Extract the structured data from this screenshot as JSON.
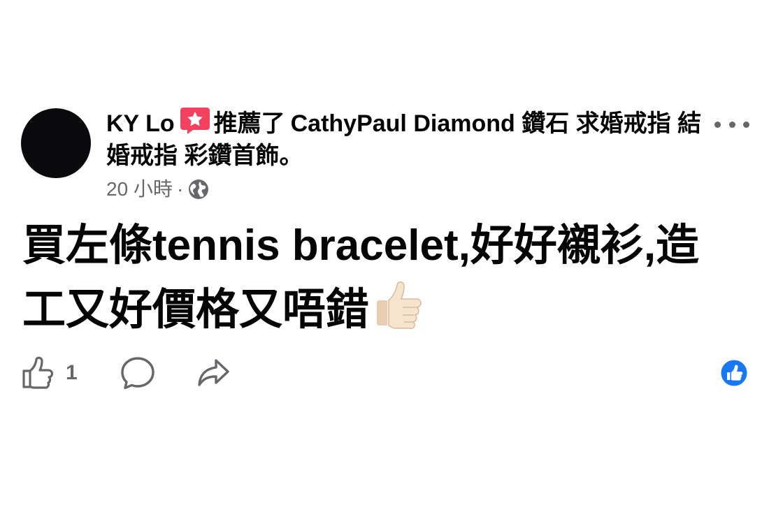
{
  "post": {
    "author": "KY Lo",
    "verb": "推薦了",
    "page_name": "CathyPaul Diamond 鑽石 求婚戒指 結婚戒指 彩鑽首飾。",
    "timestamp": "20 小時",
    "separator": "·",
    "privacy_icon": "globe-icon",
    "body": "買左條tennis bracelet,好好襯衫,造工又好價格又唔錯",
    "emoji": "thumbs-up-light-skin-emoji"
  },
  "actions": {
    "like_count": "1",
    "like_icon": "thumbs-up-outline-icon",
    "comment_icon": "comment-bubble-icon",
    "share_icon": "share-arrow-icon"
  },
  "reaction": {
    "icon": "like-reaction-badge",
    "color": "#1877f2"
  },
  "colors": {
    "recommend_badge": "#f3425f",
    "secondary_text": "#65676b",
    "primary_text": "#050505"
  }
}
